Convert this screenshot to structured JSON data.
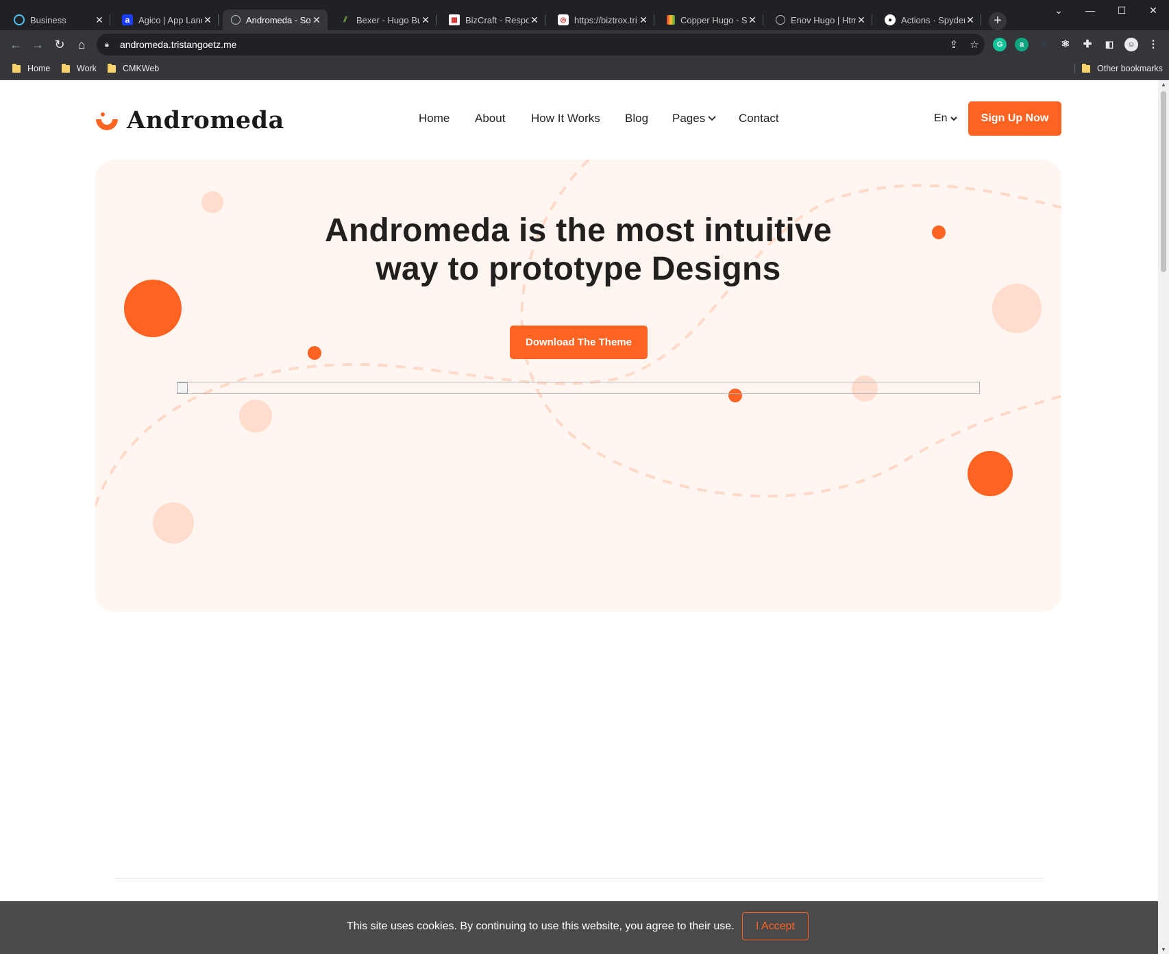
{
  "browser": {
    "tabs": [
      {
        "title": "Business",
        "icon": "circle-logo-icon",
        "active": false
      },
      {
        "title": "Agico | App Landi",
        "icon": "a-logo-icon",
        "active": false
      },
      {
        "title": "Andromeda - Soft",
        "icon": "globe-icon",
        "active": true
      },
      {
        "title": "Bexer - Hugo Busi",
        "icon": "bexer-logo-icon",
        "active": false
      },
      {
        "title": "BizCraft - Respon",
        "icon": "bizcraft-logo-icon",
        "active": false
      },
      {
        "title": "https://biztrox.tri",
        "icon": "biztrox-logo-icon",
        "active": false
      },
      {
        "title": "Copper Hugo - Si",
        "icon": "copper-logo-icon",
        "active": false
      },
      {
        "title": "Enov Hugo | Html",
        "icon": "globe-icon",
        "active": false
      },
      {
        "title": "Actions · SpyderH",
        "icon": "github-icon",
        "active": false
      }
    ],
    "url": "andromeda.tristangoetz.me",
    "bookmarks": [
      "Home",
      "Work",
      "CMKWeb"
    ],
    "other_bookmarks": "Other bookmarks"
  },
  "site": {
    "logo_text": "Andromeda",
    "nav": [
      "Home",
      "About",
      "How It Works",
      "Blog",
      "Pages",
      "Contact"
    ],
    "language": "En",
    "signup_label": "Sign Up Now",
    "hero": {
      "title_line1": "Andromeda is the most intuitive",
      "title_line2": "way to prototype Designs",
      "download_label": "Download The Theme"
    },
    "cookie": {
      "text": "This site uses cookies. By continuing to use this website, you agree to their use.",
      "accept_label": "I Accept"
    }
  },
  "colors": {
    "accent": "#fe6322",
    "hero_bg": "#fff5f1",
    "light_circle": "#ffdccb",
    "text_dark": "#221f1f",
    "cookie_bg": "#4a4a4a"
  }
}
